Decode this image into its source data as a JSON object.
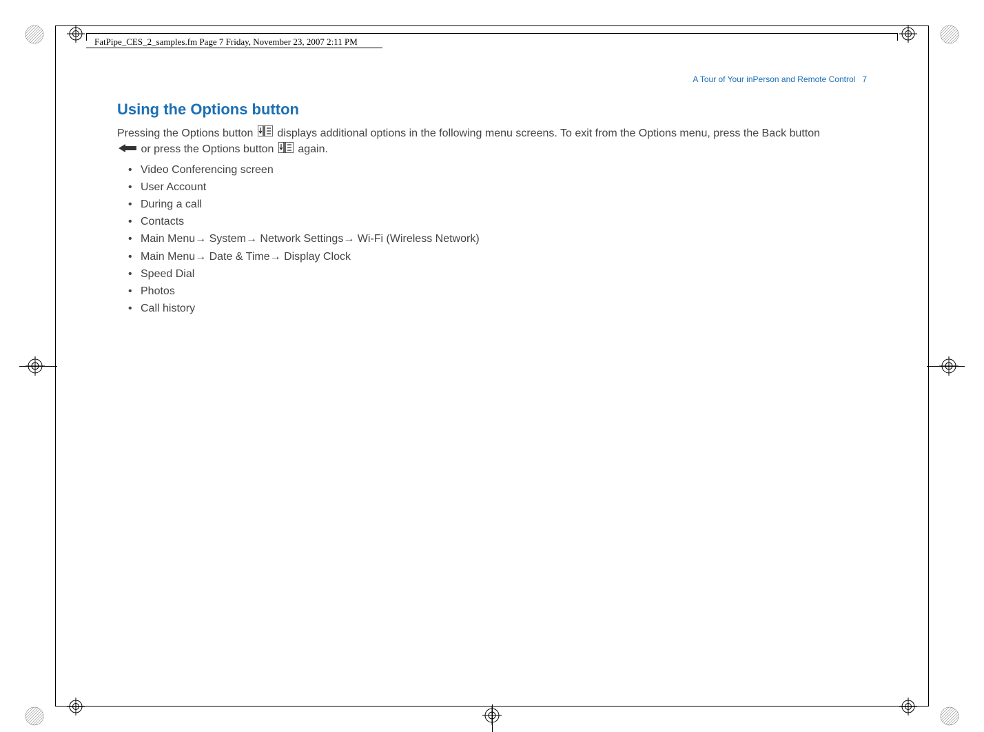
{
  "header": {
    "framemaker_label": "FatPipe_CES_2_samples.fm  Page 7  Friday, November 23, 2007  2:11 PM"
  },
  "running_header": {
    "text": "A Tour of Your inPerson and Remote Control",
    "page_number": "7"
  },
  "section": {
    "title": "Using the Options button",
    "intro_part1": "Pressing the Options button ",
    "intro_part2": " displays additional options in the following menu screens. To exit from the Options menu, press the Back button ",
    "intro_part3": " or press the Options button ",
    "intro_part4": " again.",
    "bullets": [
      "Video Conferencing screen",
      "User Account",
      "During a call",
      "Contacts",
      "Main Menu→ System→ Network Settings→ Wi-Fi (Wireless Network)",
      "Main Menu→ Date & Time→ Display Clock",
      "Speed Dial",
      "Photos",
      "Call history"
    ]
  }
}
